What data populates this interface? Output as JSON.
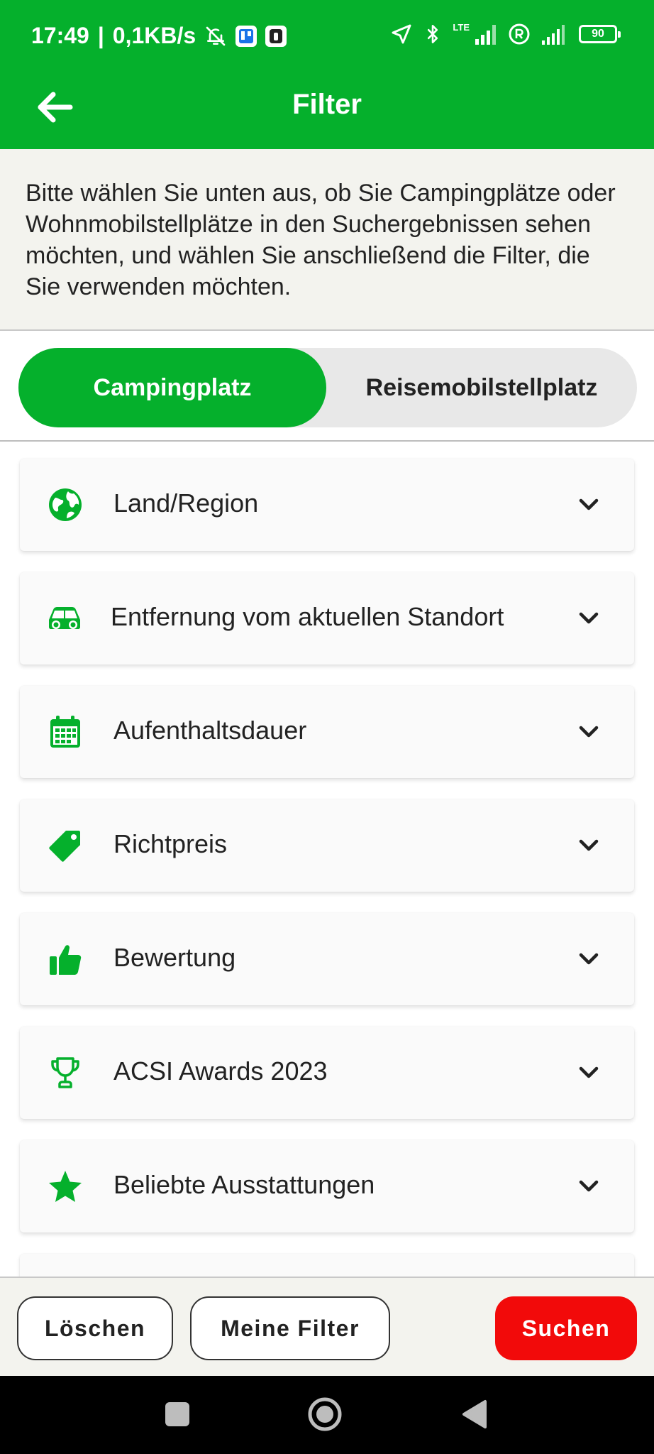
{
  "status_bar": {
    "time": "17:49",
    "separator": "|",
    "network_speed": "0,1KB/s",
    "lte_label": "LTE",
    "battery_level": "90",
    "icons": [
      "muted-bell-icon",
      "trello-icon",
      "app-icon",
      "location-icon",
      "bluetooth-icon",
      "signal-icon",
      "registered-icon",
      "signal-icon",
      "battery-icon"
    ]
  },
  "app_bar": {
    "title": "Filter",
    "back_icon": "arrow-left-icon"
  },
  "intro": {
    "text": "Bitte wählen Sie unten aus, ob Sie Campingplätze oder Wohnmobilstellplätze in den Suchergebnissen sehen möchten, und wählen Sie anschließend die Filter, die Sie verwenden möchten."
  },
  "type_toggle": {
    "options": [
      {
        "label": "Campingplatz",
        "selected": true
      },
      {
        "label": "Reisemobilstellplatz",
        "selected": false
      }
    ]
  },
  "filters": [
    {
      "label": "Land/Region",
      "icon": "globe-icon"
    },
    {
      "label": "Entfernung vom aktuellen Standort",
      "icon": "car-icon"
    },
    {
      "label": "Aufenthaltsdauer",
      "icon": "calendar-icon"
    },
    {
      "label": "Richtpreis",
      "icon": "price-tag-icon"
    },
    {
      "label": "Bewertung",
      "icon": "thumbs-up-icon"
    },
    {
      "label": "ACSI Awards 2023",
      "icon": "trophy-icon"
    },
    {
      "label": "Beliebte Ausstattungen",
      "icon": "star-icon"
    }
  ],
  "bottom_bar": {
    "clear_label": "Löschen",
    "my_filters_label": "Meine Filter",
    "search_label": "Suchen"
  },
  "colors": {
    "brand_green": "#05b02c",
    "search_red": "#f20a0a",
    "background": "#f3f3ee"
  }
}
